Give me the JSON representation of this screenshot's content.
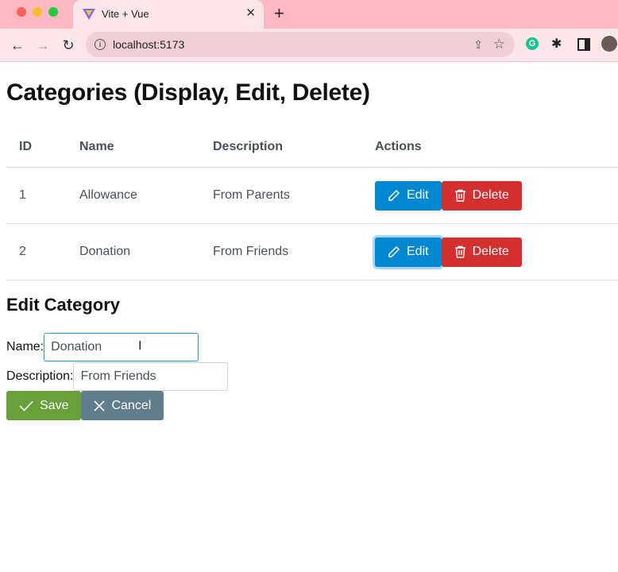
{
  "browser": {
    "tab_title": "Vite + Vue",
    "url": "localhost:5173"
  },
  "page": {
    "title": "Categories (Display, Edit, Delete)",
    "table": {
      "headers": [
        "ID",
        "Name",
        "Description",
        "Actions"
      ],
      "rows": [
        {
          "id": "1",
          "name": "Allowance",
          "description": "From Parents"
        },
        {
          "id": "2",
          "name": "Donation",
          "description": "From Friends"
        }
      ],
      "edit_label": "Edit",
      "delete_label": "Delete"
    },
    "edit_form": {
      "heading": "Edit Category",
      "name_label": "Name:",
      "name_value": "Donation",
      "description_label": "Description:",
      "description_value": "From Friends",
      "save_label": "Save",
      "cancel_label": "Cancel"
    }
  },
  "colors": {
    "edit": "#0288d1",
    "delete": "#d32f2f",
    "save": "#689f38",
    "cancel": "#607d8b",
    "tabstrip": "#fdb8c4"
  }
}
